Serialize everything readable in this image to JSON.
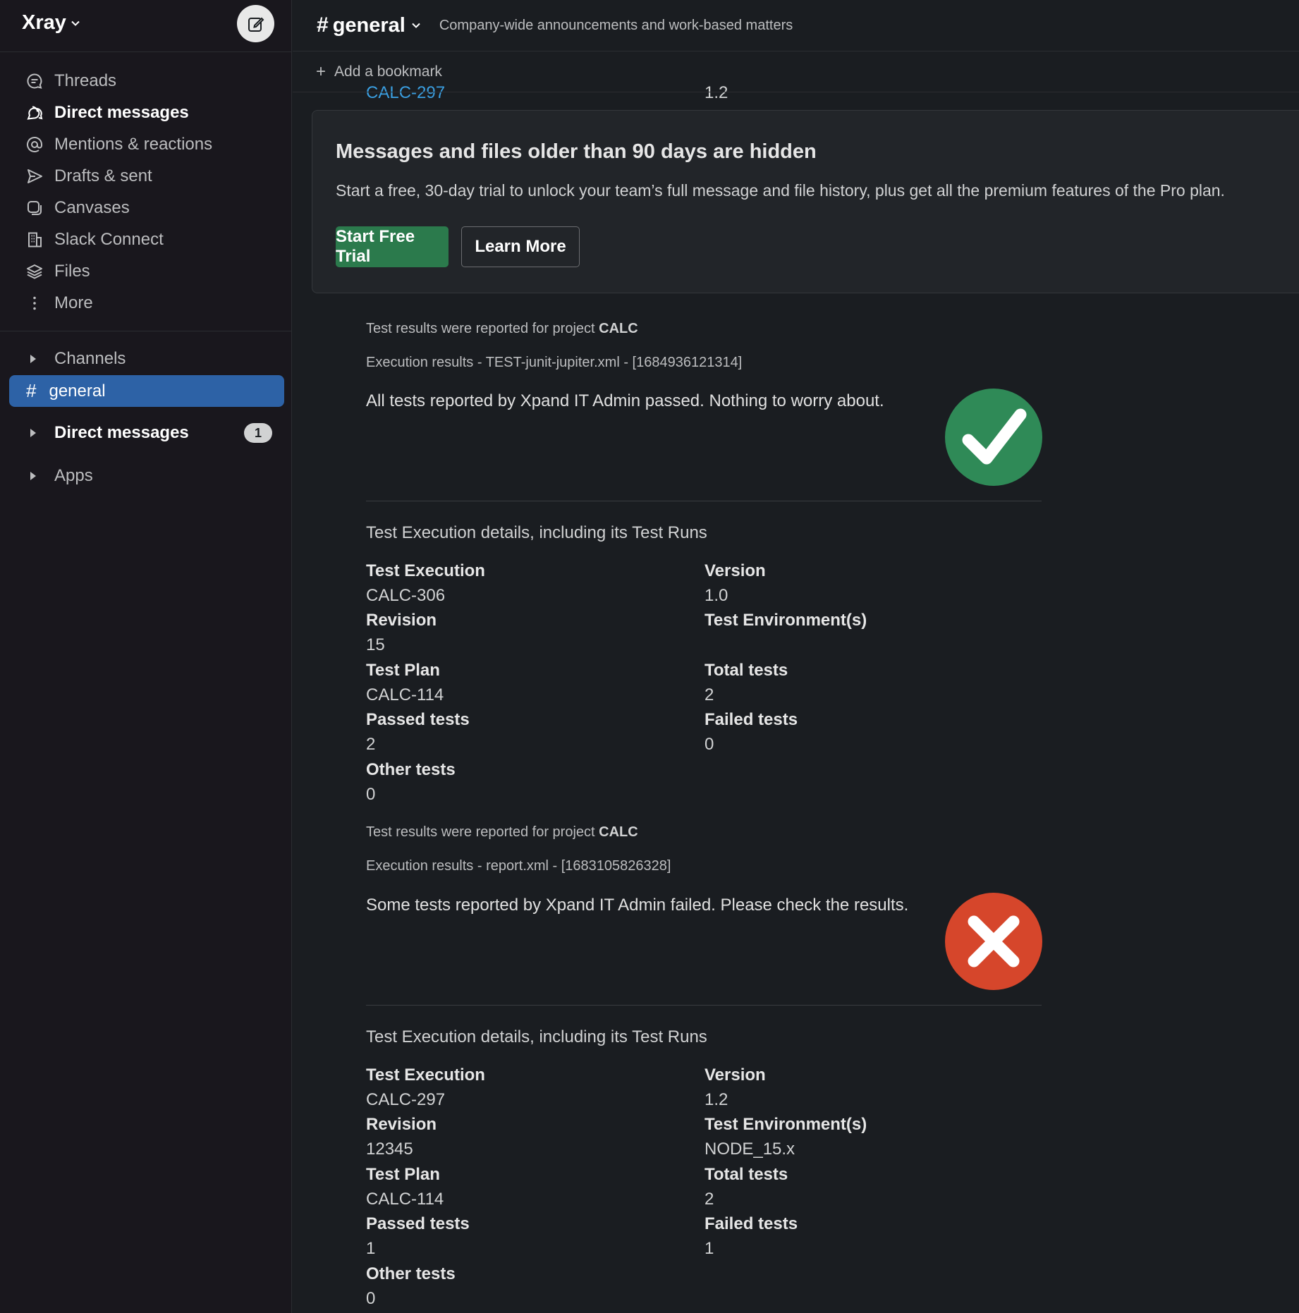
{
  "workspace": {
    "name": "Xray"
  },
  "nav": [
    {
      "label": "Threads",
      "icon": "threads-icon",
      "bold": false
    },
    {
      "label": "Direct messages",
      "icon": "direct-messages-icon",
      "bold": true
    },
    {
      "label": "Mentions & reactions",
      "icon": "mentions-icon",
      "bold": false
    },
    {
      "label": "Drafts & sent",
      "icon": "drafts-icon",
      "bold": false
    },
    {
      "label": "Canvases",
      "icon": "canvases-icon",
      "bold": false
    },
    {
      "label": "Slack Connect",
      "icon": "slack-connect-icon",
      "bold": false
    },
    {
      "label": "Files",
      "icon": "files-icon",
      "bold": false
    },
    {
      "label": "More",
      "icon": "more-icon",
      "bold": false
    }
  ],
  "sections": {
    "channels": "Channels",
    "active_channel": "general",
    "direct_messages": "Direct messages",
    "direct_messages_badge": "1",
    "apps": "Apps"
  },
  "channel": {
    "hash": "#",
    "name": "general",
    "topic": "Company-wide announcements and work-based matters"
  },
  "bookmark": {
    "plus": "+",
    "label": "Add a bookmark"
  },
  "partial_top": {
    "link": "CALC-297",
    "value": "1.2"
  },
  "banner": {
    "title": "Messages and files older than 90 days are hidden",
    "body": "Start a free, 30-day trial to unlock your team’s full message and file history, plus get all the premium features of the Pro plan.",
    "primary": "Start Free Trial",
    "secondary": "Learn More"
  },
  "reports": [
    {
      "project_prefix": "Test results were reported for project ",
      "project": "CALC",
      "execution": "Execution results - TEST-junit-jupiter.xml - [1684936121314]",
      "message": "All tests reported by Xpand IT Admin passed. Nothing to worry about.",
      "status": "passed",
      "details_title": "Test Execution details, including its Test Runs",
      "labels": {
        "test_execution": "Test Execution",
        "version": "Version",
        "revision": "Revision",
        "test_env": "Test Environment(s)",
        "test_plan": "Test Plan",
        "total": "Total tests",
        "passed": "Passed tests",
        "failed": "Failed tests",
        "other": "Other tests"
      },
      "values": {
        "test_execution": "CALC-306",
        "version": "1.0",
        "revision": "15",
        "test_env": "",
        "test_plan": "CALC-114",
        "total": "2",
        "passed": "2",
        "failed": "0",
        "other": "0"
      }
    },
    {
      "project_prefix": "Test results were reported for project ",
      "project": "CALC",
      "execution": "Execution results - report.xml - [1683105826328]",
      "message": "Some tests reported by Xpand IT Admin failed. Please check the results.",
      "status": "failed",
      "details_title": "Test Execution details, including its Test Runs",
      "labels": {
        "test_execution": "Test Execution",
        "version": "Version",
        "revision": "Revision",
        "test_env": "Test Environment(s)",
        "test_plan": "Test Plan",
        "total": "Total tests",
        "passed": "Passed tests",
        "failed": "Failed tests",
        "other": "Other tests"
      },
      "values": {
        "test_execution": "CALC-297",
        "version": "1.2",
        "revision": "12345",
        "test_env": "NODE_15.x",
        "test_plan": "CALC-114",
        "total": "2",
        "passed": "1",
        "failed": "1",
        "other": "0"
      }
    }
  ],
  "colors": {
    "accent": "#2d62a6",
    "trial_button": "#2b7a4c",
    "link": "#3a9ee0",
    "pass": "#2f8a57",
    "fail": "#d6462b"
  }
}
